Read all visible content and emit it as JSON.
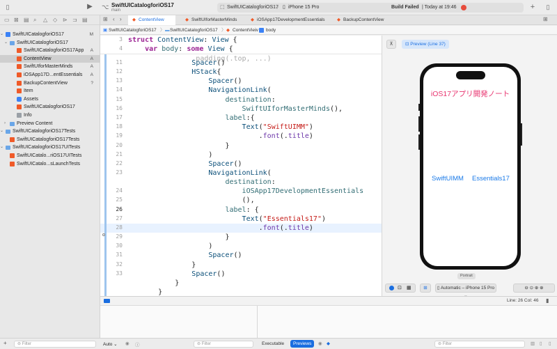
{
  "toolbar": {
    "project_name": "SwiftUICatalogforiOS17",
    "branch": "main",
    "scheme": "SwiftUICatalogforiOS17",
    "destination": "iPhone 15 Pro",
    "status": "Build Failed",
    "status_time": "| Today at 19:46"
  },
  "tabs": [
    {
      "label": "ContentView",
      "active": true
    },
    {
      "label": "SwiftUIforMasterMinds",
      "active": false
    },
    {
      "label": "iOSApp17DevelopmentEssentials",
      "active": false
    },
    {
      "label": "BackupContentView",
      "active": false
    }
  ],
  "breadcrumb": [
    "SwiftUICatalogforiOS17",
    "SwiftUICatalogforiOS17",
    "ContentView",
    "body"
  ],
  "navigator": {
    "items": [
      {
        "label": "SwiftUICatalogforiOS17",
        "kind": "project",
        "badge": "M",
        "selected": false
      },
      {
        "label": "SwiftUICatalogforiOS17",
        "kind": "folder",
        "badge": "",
        "selected": false
      },
      {
        "label": "SwiftUICatalogforiOS17App",
        "kind": "swift",
        "badge": "A",
        "selected": false
      },
      {
        "label": "ContentView",
        "kind": "swift",
        "badge": "A",
        "selected": true
      },
      {
        "label": "SwiftUIforMasterMinds",
        "kind": "swift",
        "badge": "A",
        "selected": false
      },
      {
        "label": "iOSApp17D...entEssentials",
        "kind": "swift",
        "badge": "A",
        "selected": false
      },
      {
        "label": "BackupContentView",
        "kind": "swift",
        "badge": "?",
        "selected": false
      },
      {
        "label": "Item",
        "kind": "swift",
        "badge": "",
        "selected": false
      },
      {
        "label": "Assets",
        "kind": "assets",
        "badge": "",
        "selected": false
      },
      {
        "label": "SwiftUICatalogforiOS17",
        "kind": "swift",
        "badge": "",
        "selected": false
      },
      {
        "label": "Info",
        "kind": "info",
        "badge": "",
        "selected": false
      },
      {
        "label": "Preview Content",
        "kind": "folder",
        "badge": "",
        "selected": false
      },
      {
        "label": "SwiftUICatalogforiOS17Tests",
        "kind": "folder",
        "badge": "",
        "selected": false
      },
      {
        "label": "SwiftUICatalogforiOS17Tests",
        "kind": "swift",
        "badge": "",
        "selected": false
      },
      {
        "label": "SwiftUICatalogforiOS17UITests",
        "kind": "folder",
        "badge": "",
        "selected": false
      },
      {
        "label": "SwiftUICatalo...riOS17UITests",
        "kind": "swift",
        "badge": "",
        "selected": false
      },
      {
        "label": "SwiftUICatalo...sLaunchTests",
        "kind": "swift",
        "badge": "",
        "selected": false
      }
    ]
  },
  "editor": {
    "sticky_numbers": [
      "3",
      "4"
    ],
    "line_numbers": [
      "11",
      "12",
      "13",
      "14",
      "15",
      "16",
      "17",
      "18",
      "19",
      "20",
      "21",
      "22",
      "23",
      "",
      "24",
      "25",
      "26",
      "27",
      "28",
      "29",
      "30",
      "31",
      "32",
      "33"
    ],
    "current_line": "26"
  },
  "canvas": {
    "preview_label": "Preview (Line 37)",
    "phone_title": "iOS17アプリ開発ノート",
    "link1": "SwiftUIMM",
    "link2": "Essentials17",
    "orientation": "Portrait",
    "device_menu": "Automatic – iPhone 15 Pro"
  },
  "status_bar": {
    "cursor": "Line: 26  Col: 46"
  },
  "bottom": {
    "filter_placeholder": "Filter",
    "auto_label": "Auto",
    "executable_label": "Executable",
    "previews_label": "Previews"
  },
  "colors": {
    "accent": "#1a6ee0",
    "phone_title": "#e8336f",
    "link": "#1a7ae8",
    "selection": "#e8f2ff"
  }
}
